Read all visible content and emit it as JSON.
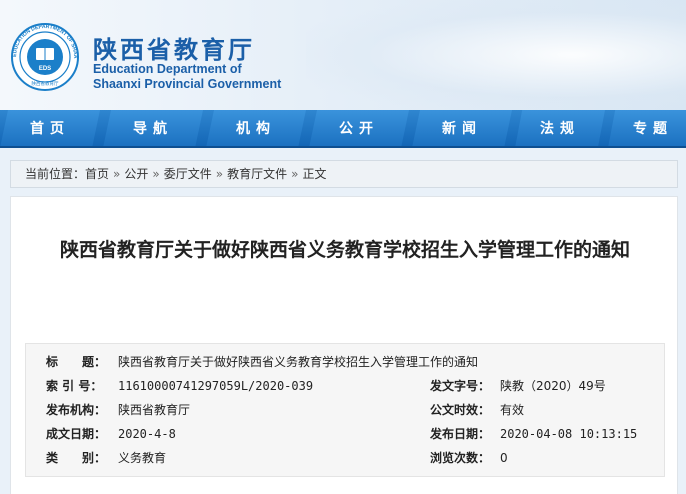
{
  "site": {
    "name_cn": "陕西省教育厅",
    "name_en_line1": "Education Department of",
    "name_en_line2": "Shaanxi Provincial Government",
    "logo_ring_text": "EDUCATION DEPARTMENT OF SHAANXI",
    "logo_center_text": "EDS",
    "logo_bottom_text": "陕西省教育厅"
  },
  "nav": {
    "items": [
      "首页",
      "导航",
      "机构",
      "公开",
      "新闻",
      "法规",
      "专题"
    ]
  },
  "breadcrumb": {
    "prefix": "当前位置：",
    "items": [
      "首页",
      "公开",
      "委厅文件",
      "教育厅文件",
      "正文"
    ],
    "separator": "»"
  },
  "article": {
    "title": "陕西省教育厅关于做好陕西省义务教育学校招生入学管理工作的通知"
  },
  "info": {
    "title_label": "标　　题：",
    "title_value": "陕西省教育厅关于做好陕西省义务教育学校招生入学管理工作的通知",
    "index_label": "索 引 号：",
    "index_value": "11610000741297059L/2020-039",
    "doc_no_label": "发文字号：",
    "doc_no_value": "陕教（2020）49号",
    "issuer_label": "发布机构：",
    "issuer_value": "陕西省教育厅",
    "validity_label": "公文时效：",
    "validity_value": "有效",
    "created_label": "成文日期：",
    "created_value": "2020-4-8",
    "published_label": "发布日期：",
    "published_value": "2020-04-08 10:13:15",
    "category_label": "类　　别：",
    "category_value": "义务教育",
    "views_label": "浏览次数：",
    "views_value": "0"
  },
  "colors": {
    "brand_blue": "#1b5fa8",
    "nav_blue": "#1a6fbf"
  }
}
